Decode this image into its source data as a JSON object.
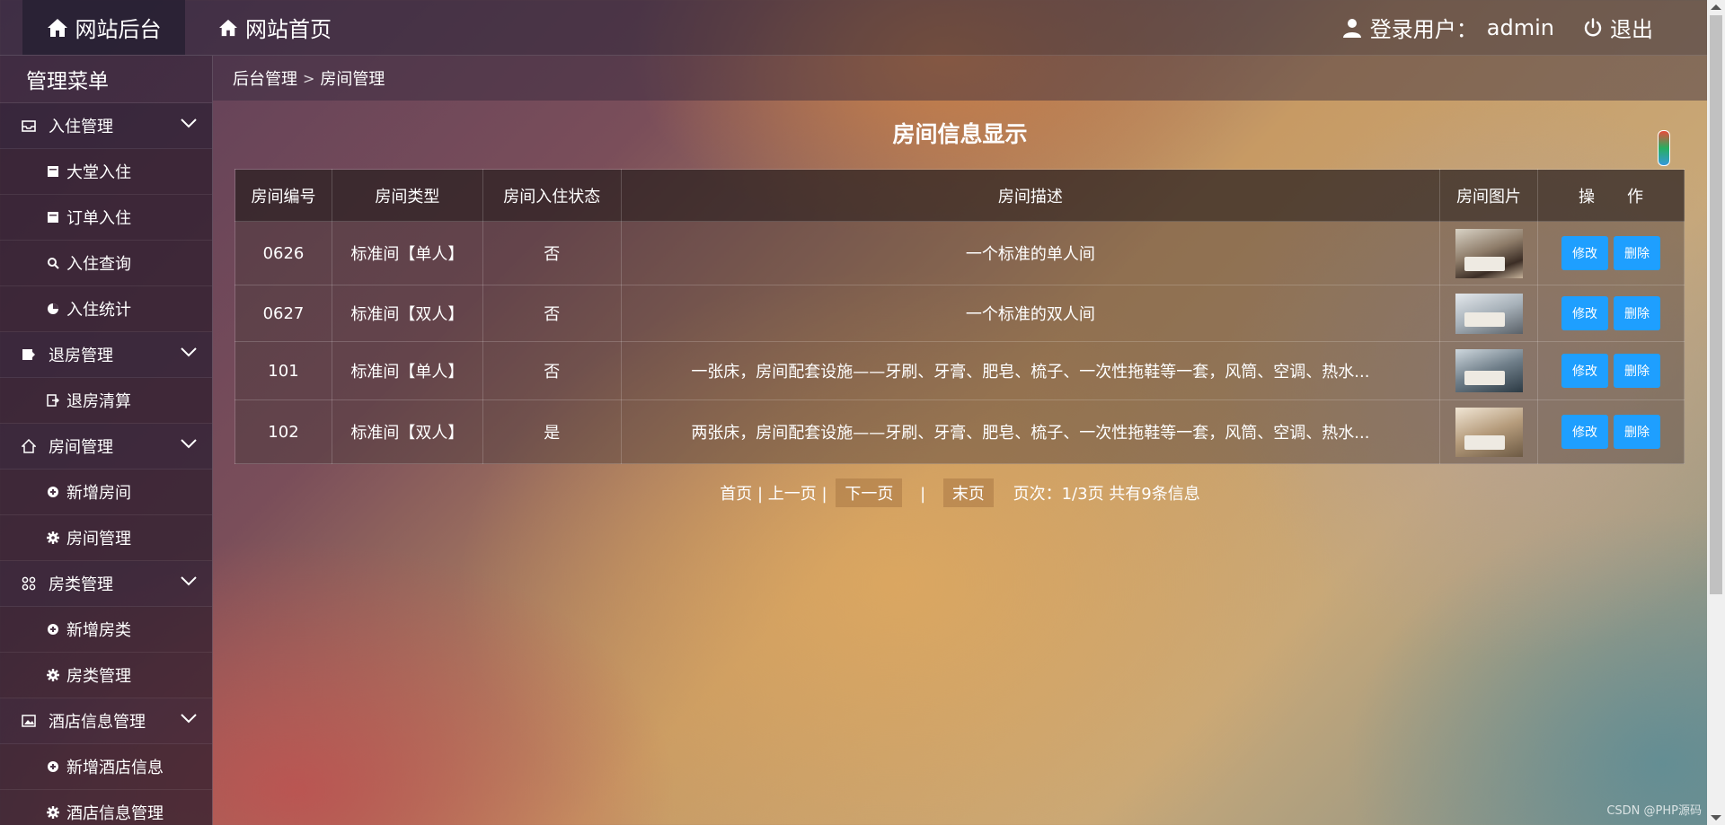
{
  "header": {
    "brand_label": "网站后台",
    "home_label": "网站首页",
    "user_prefix": "登录用户：",
    "username": "admin",
    "logout_label": "退出"
  },
  "sidebar": {
    "title": "管理菜单",
    "groups": [
      {
        "label": "入住管理",
        "icon": "inbox-icon",
        "items": [
          {
            "label": "大堂入住",
            "icon": "note-icon"
          },
          {
            "label": "订单入住",
            "icon": "note-icon"
          },
          {
            "label": "入住查询",
            "icon": "search-icon"
          },
          {
            "label": "入住统计",
            "icon": "pie-chart-icon"
          }
        ]
      },
      {
        "label": "退房管理",
        "icon": "ticket-icon",
        "items": [
          {
            "label": "退房清算",
            "icon": "exit-icon"
          }
        ]
      },
      {
        "label": "房间管理",
        "icon": "home-icon",
        "items": [
          {
            "label": "新增房间",
            "icon": "plus-circle-icon"
          },
          {
            "label": "房间管理",
            "icon": "gear-icon"
          }
        ]
      },
      {
        "label": "房类管理",
        "icon": "apps-icon",
        "items": [
          {
            "label": "新增房类",
            "icon": "plus-circle-icon"
          },
          {
            "label": "房类管理",
            "icon": "gear-icon"
          }
        ]
      },
      {
        "label": "酒店信息管理",
        "icon": "picture-icon",
        "items": [
          {
            "label": "新增酒店信息",
            "icon": "plus-circle-icon"
          },
          {
            "label": "酒店信息管理",
            "icon": "gear-icon"
          }
        ]
      }
    ]
  },
  "breadcrumb": {
    "root": "后台管理",
    "separator": ">",
    "current": "房间管理"
  },
  "page_title": "房间信息显示",
  "table": {
    "headers": [
      "房间编号",
      "房间类型",
      "房间入住状态",
      "房间描述",
      "房间图片",
      "操　　作"
    ],
    "edit_label": "修改",
    "delete_label": "删除",
    "rows": [
      {
        "number": "0626",
        "type": "标准间【单人】",
        "occupied": "否",
        "description": "一个标准的单人间"
      },
      {
        "number": "0627",
        "type": "标准间【双人】",
        "occupied": "否",
        "description": "一个标准的双人间"
      },
      {
        "number": "101",
        "type": "标准间【单人】",
        "occupied": "否",
        "description": "一张床，房间配套设施——牙刷、牙膏、肥皂、梳子、一次性拖鞋等一套，风筒、空调、热水..."
      },
      {
        "number": "102",
        "type": "标准间【双人】",
        "occupied": "是",
        "description": "两张床，房间配套设施——牙刷、牙膏、肥皂、梳子、一次性拖鞋等一套，风筒、空调、热水..."
      }
    ]
  },
  "pagination": {
    "first": "首页",
    "sep1": "|",
    "prev": "上一页",
    "sep2": "|",
    "next": "下一页",
    "sep3": "|",
    "last": "末页",
    "info": "页次：1/3页 共有9条信息"
  },
  "watermark": "CSDN @PHP源码"
}
